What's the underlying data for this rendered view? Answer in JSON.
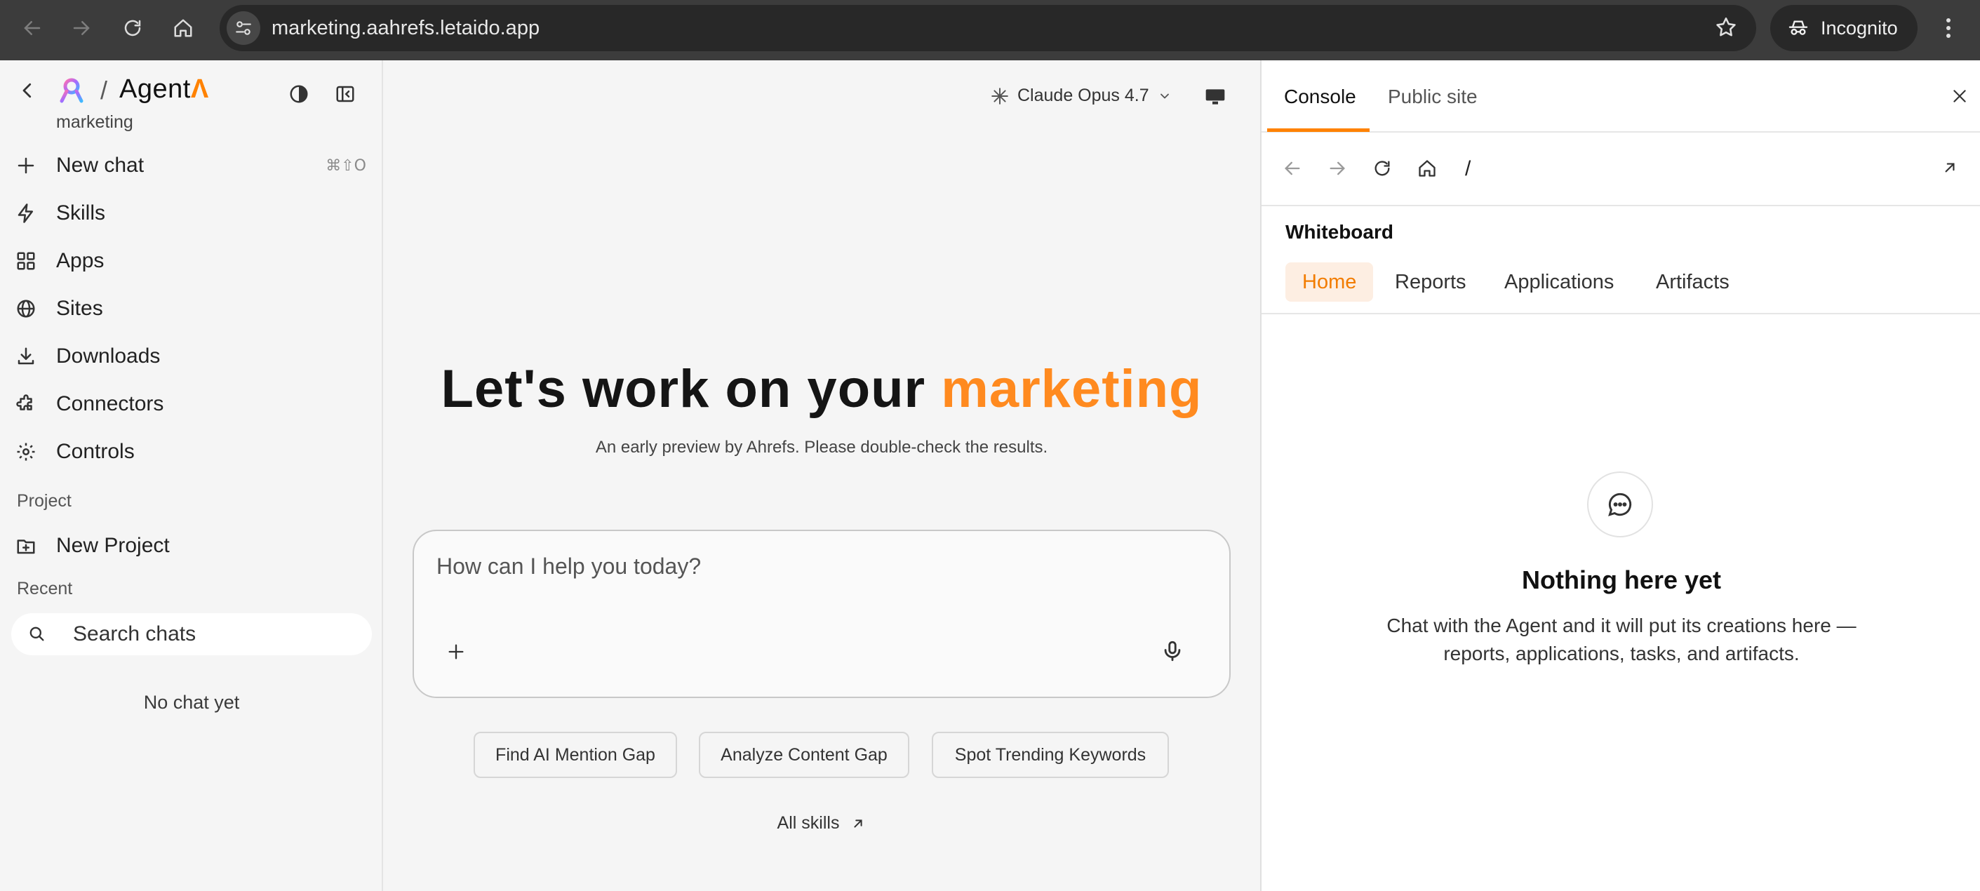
{
  "browser": {
    "url": "marketing.aahrefs.letaido.app",
    "incognito_label": "Incognito"
  },
  "sidebar": {
    "brand": "Agent",
    "brand_accent": "Λ",
    "subtitle": "marketing",
    "new_chat": {
      "label": "New chat",
      "shortcut": "⌘⇧O"
    },
    "items": [
      {
        "label": "Skills",
        "icon": "lightning-icon"
      },
      {
        "label": "Apps",
        "icon": "grid-icon"
      },
      {
        "label": "Sites",
        "icon": "globe-icon"
      },
      {
        "label": "Downloads",
        "icon": "download-icon"
      },
      {
        "label": "Connectors",
        "icon": "puzzle-icon"
      },
      {
        "label": "Controls",
        "icon": "gear-icon"
      }
    ],
    "project_header": "Project",
    "new_project": "New Project",
    "recent_header": "Recent",
    "search_placeholder": "Search chats",
    "empty_text": "No chat yet"
  },
  "main": {
    "model_name": "Claude Opus 4.7",
    "hero_prefix": "Let's work on your ",
    "hero_accent": "marketing",
    "hero_sub": "An early preview by Ahrefs. Please double-check the results.",
    "composer_placeholder": "How can I help you today?",
    "suggestions": [
      "Find AI Mention Gap",
      "Analyze Content Gap",
      "Spot Trending Keywords"
    ],
    "all_skills": "All skills"
  },
  "panel": {
    "tabs": [
      "Console",
      "Public site"
    ],
    "path": "/",
    "whiteboard_title": "Whiteboard",
    "whiteboard_tabs": [
      "Home",
      "Reports",
      "Applications",
      "Artifacts"
    ],
    "empty_title": "Nothing here yet",
    "empty_desc_line1": "Chat with the Agent and it will put its creations here —",
    "empty_desc_line2": "reports, applications, tasks, and artifacts."
  },
  "colors": {
    "accent": "#ff8200",
    "chrome_bg": "#3c3c3c",
    "sidebar_bg": "#f5f5f5"
  }
}
